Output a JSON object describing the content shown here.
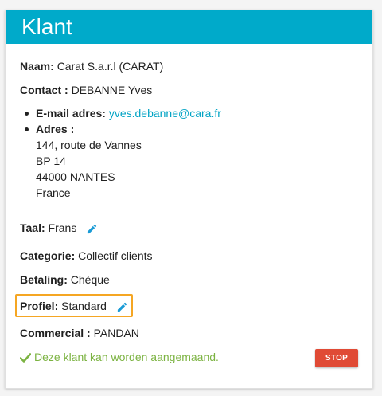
{
  "card": {
    "title": "Klant"
  },
  "client": {
    "name_label": "Naam:",
    "name_value": "Carat S.a.r.l (CARAT)",
    "contact_label": "Contact :",
    "contact_value": "DEBANNE Yves",
    "email_label": "E-mail adres:",
    "email_value": "yves.debanne@cara.fr",
    "address_label": "Adres :",
    "address_lines": [
      "144, route de Vannes",
      "BP 14",
      "44000 NANTES",
      "France"
    ],
    "language_label": "Taal:",
    "language_value": "Frans",
    "category_label": "Categorie:",
    "category_value": "Collectif clients",
    "payment_label": "Betaling:",
    "payment_value": "Chèque",
    "profile_label": "Profiel:",
    "profile_value": "Standard",
    "commercial_label": "Commercial :",
    "commercial_value": "PANDAN"
  },
  "status": {
    "text": "Deze klant kan worden aangemaand.",
    "button_label": "STOP"
  },
  "colors": {
    "header": "#00aaca",
    "link": "#00a3c4",
    "status_green": "#7cb342",
    "stop_red": "#e04a35",
    "highlight_border": "#f5a623",
    "pencil": "#1a9bd6"
  },
  "icons": {
    "edit": "pencil-icon",
    "status": "check-icon"
  }
}
